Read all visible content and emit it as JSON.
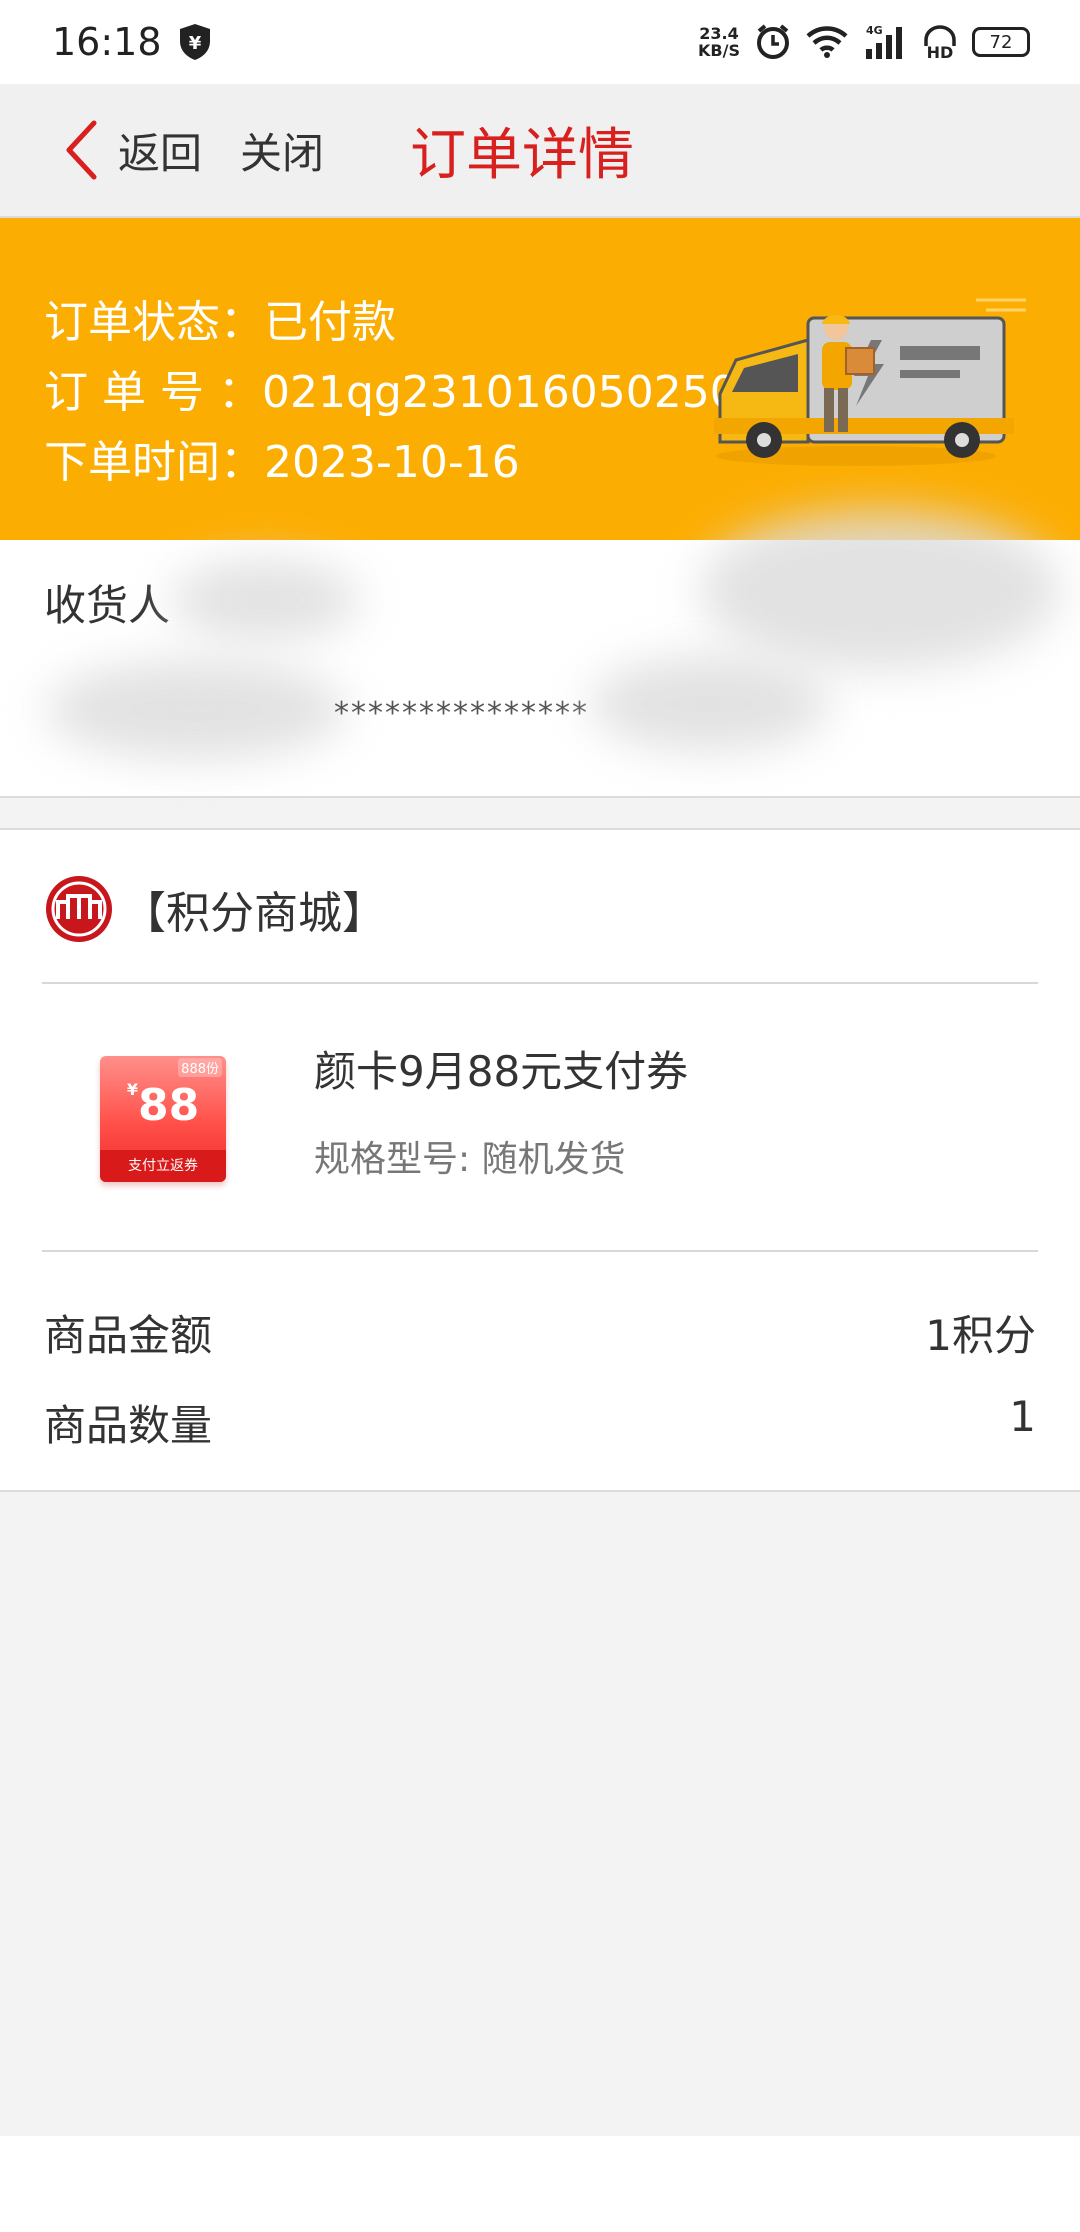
{
  "status_bar": {
    "time": "16:18",
    "net_speed_value": "23.4",
    "net_speed_unit": "KB/S",
    "network": "4G",
    "hd": "HD",
    "battery": "72",
    "icons": [
      "shield-icon",
      "alarm-icon",
      "wifi-icon",
      "signal-icon",
      "battery-icon"
    ]
  },
  "nav": {
    "back_label": "返回",
    "close_label": "关闭",
    "title": "订单详情",
    "title_color": "#d8201e"
  },
  "order": {
    "status_label": "订单状态：",
    "status_value": "已付款",
    "number_label": "订 单 号 ：",
    "number_value": "021qg23101605025001",
    "time_label": "下单时间：",
    "time_value": "2023-10-16",
    "banner_color": "#fcad01"
  },
  "receiver": {
    "label": "收货人",
    "phone_masked": "***************"
  },
  "shop": {
    "name": "【积分商城】"
  },
  "product": {
    "name": "颜卡9月88元支付券",
    "spec": "规格型号: 随机发货",
    "coupon": {
      "top_text": "888份",
      "currency": "¥",
      "value": "88",
      "bottom_text": "支付立返券"
    }
  },
  "summary": {
    "amount_label": "商品金额",
    "amount_value": "1积分",
    "quantity_label": "商品数量",
    "quantity_value": "1"
  }
}
